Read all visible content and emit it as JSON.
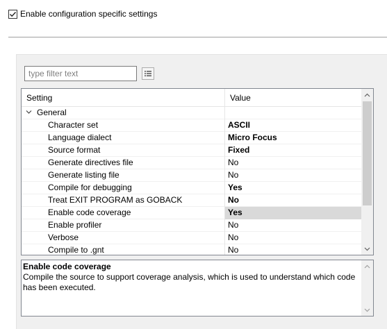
{
  "enable_settings": {
    "label": "Enable configuration specific settings",
    "checked": true
  },
  "filter": {
    "placeholder": "type filter text",
    "value": "",
    "button_icon": "filter-options-icon"
  },
  "table": {
    "columns": {
      "setting": "Setting",
      "value": "Value"
    },
    "group": {
      "label": "General",
      "expanded": true
    },
    "rows": [
      {
        "setting": "Character set",
        "value": "ASCII",
        "bold": true
      },
      {
        "setting": "Language dialect",
        "value": "Micro Focus",
        "bold": true
      },
      {
        "setting": "Source format",
        "value": "Fixed",
        "bold": true
      },
      {
        "setting": "Generate directives file",
        "value": "No",
        "bold": false
      },
      {
        "setting": "Generate listing file",
        "value": "No",
        "bold": false
      },
      {
        "setting": "Compile for debugging",
        "value": "Yes",
        "bold": true
      },
      {
        "setting": "Treat EXIT PROGRAM as GOBACK",
        "value": "No",
        "bold": true
      },
      {
        "setting": "Enable code coverage",
        "value": "Yes",
        "bold": true,
        "selected": true
      },
      {
        "setting": "Enable profiler",
        "value": "No",
        "bold": false
      },
      {
        "setting": "Verbose",
        "value": "No",
        "bold": false
      },
      {
        "setting": "Compile to .gnt",
        "value": "No",
        "bold": false
      }
    ]
  },
  "description": {
    "title": "Enable code coverage",
    "text": "Compile the source to support coverage analysis, which is used to understand which code has been executed."
  },
  "colors": {
    "selected_row": "#d9d9d9",
    "panel_bg": "#f0f0f0",
    "border": "#828790"
  }
}
